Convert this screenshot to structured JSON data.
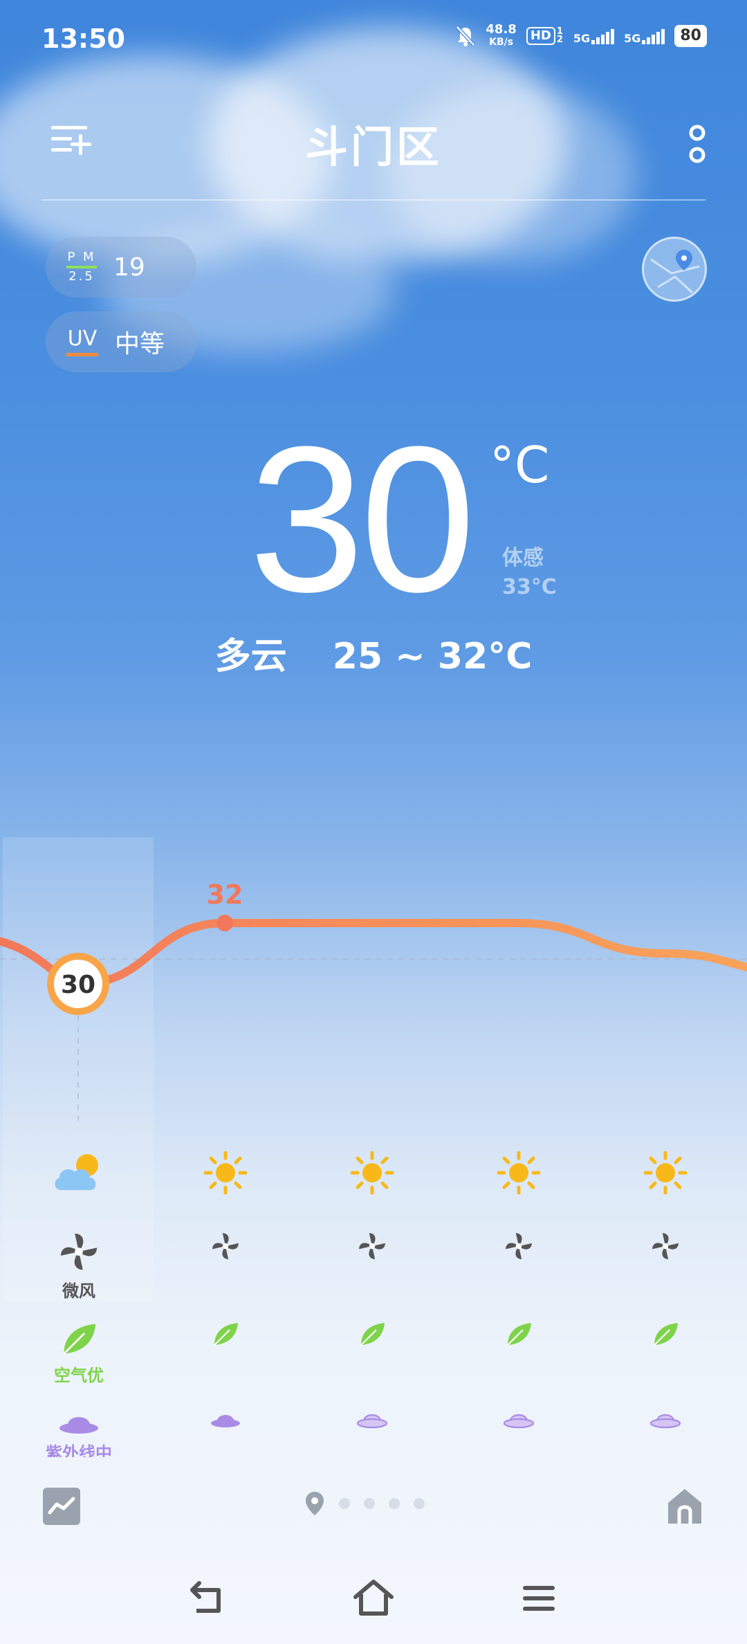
{
  "status_bar": {
    "time": "13:50",
    "net_speed_value": "48.8",
    "net_speed_unit": "KB/s",
    "hd_label": "HD",
    "hd_sub": "1 2",
    "sim1": "5G",
    "sim2": "5G",
    "battery": "80"
  },
  "header": {
    "title": "斗门区",
    "menu_icon": "add-list-icon",
    "more_icon": "more-vertical-icon"
  },
  "badges": {
    "pm_top": "P M",
    "pm_bottom": "2.5",
    "pm_value": "19",
    "uv_label": "UV",
    "uv_value": "中等"
  },
  "current": {
    "temperature": "30",
    "unit": "°C",
    "feels_label": "体感",
    "feels_value": "33°C",
    "condition": "多云",
    "range": "25 ~ 32°C"
  },
  "chart_data": {
    "type": "line",
    "x": [
      0,
      1,
      2,
      3,
      4
    ],
    "values": [
      30,
      32,
      32,
      32,
      31
    ],
    "labels": [
      "30",
      "32"
    ],
    "ylim": [
      28,
      33
    ]
  },
  "hourly": {
    "weather_icons": [
      "partly-cloudy-icon",
      "sun-icon",
      "sun-icon",
      "sun-icon",
      "sun-icon"
    ],
    "wind_label": "微风",
    "air_label": "空气优",
    "uv_label": "紫外线中"
  },
  "colors": {
    "temp_line": "#f3775a",
    "sun": "#f9b81a",
    "leaf": "#7fd34a",
    "hat": "#a98be6",
    "pm_bar": "#8fe05c",
    "uv_bar": "#f08a3c"
  },
  "bottom": {
    "trend_icon": "trend-chart-icon",
    "location_icon": "location-pin-icon",
    "page_dots": 4,
    "home_icon": "home-icon"
  },
  "navbar": {
    "back_icon": "back-icon",
    "home_icon": "home-outline-icon",
    "menu_icon": "menu-lines-icon"
  }
}
